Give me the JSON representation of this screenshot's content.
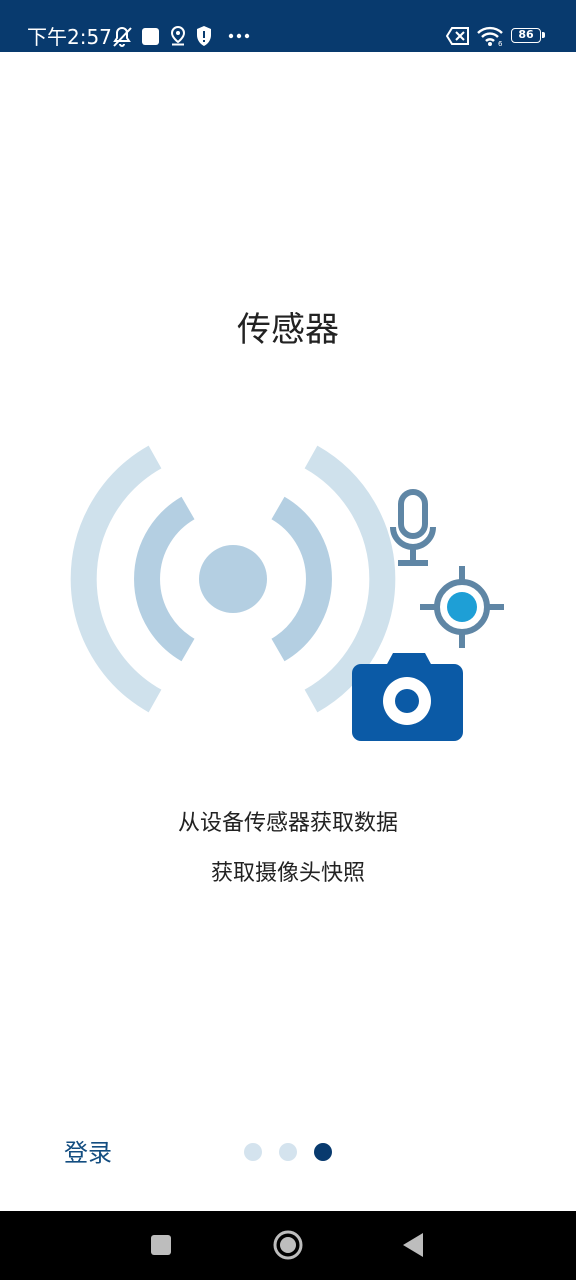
{
  "status_bar": {
    "time": "下午2:57",
    "battery": "86",
    "icons": [
      "muted-notification-icon",
      "app-square-icon",
      "location-icon",
      "shield-icon",
      "more-icon",
      "no-sim-icon",
      "wifi-icon",
      "battery-icon"
    ]
  },
  "page": {
    "title": "传感器",
    "description_lines": [
      "从设备传感器获取数据",
      "获取摄像头快照"
    ]
  },
  "footer": {
    "login_label": "登录",
    "page_indicator": {
      "total": 3,
      "active_index": 2
    }
  },
  "navigation_bar": {
    "buttons": [
      "recent-apps",
      "home",
      "back"
    ]
  },
  "colors": {
    "status_bar_bg": "#083a6e",
    "accent": "#0b5aa6",
    "wave_light": "#cfe1ec",
    "wave_mid": "#b4cfe2",
    "dot_inactive": "#d4e3ee",
    "dot_active": "#083a6e"
  }
}
